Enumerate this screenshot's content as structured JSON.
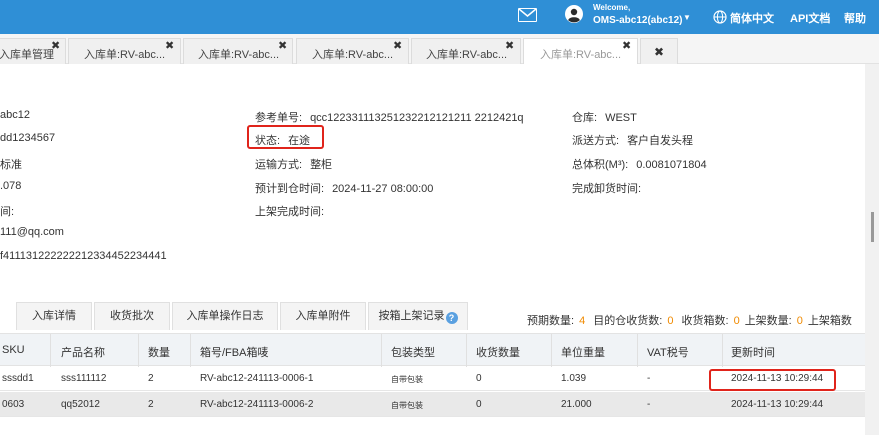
{
  "header": {
    "welcome": "Welcome,",
    "user": "OMS-abc12(abc12)",
    "language": "简体中文",
    "api_doc": "API文档",
    "help": "帮助"
  },
  "tabs": [
    {
      "label": "入库单管理",
      "active": false
    },
    {
      "label": "入库单:RV-abc...",
      "active": false
    },
    {
      "label": "入库单:RV-abc...",
      "active": false
    },
    {
      "label": "入库单:RV-abc...",
      "active": false
    },
    {
      "label": "入库单:RV-abc...",
      "active": false
    },
    {
      "label": "入库单:RV-abc...",
      "active": true
    }
  ],
  "details": {
    "col1": [
      "abc12",
      "dd1234567",
      "标准",
      ".078",
      "间:",
      "111@qq.com",
      "f411131222222212334452234441"
    ],
    "ref_label": "参考单号:",
    "ref_value": "qcc122331113251232212121211 2212421q",
    "status_label": "状态:",
    "status_value": "在途",
    "transport_label": "运输方式:",
    "transport_value": "整柜",
    "eta_label": "预计到仓时间:",
    "eta_value": "2024-11-27 08:00:00",
    "shelf_done_label": "上架完成时间:",
    "warehouse_label": "仓库:",
    "warehouse_value": "WEST",
    "delivery_label": "派送方式:",
    "delivery_value": "客户自发头程",
    "volume_label": "总体积(M³):",
    "volume_value": "0.0081071804",
    "unload_done_label": "完成卸货时间:"
  },
  "subtabs": [
    "入库详情",
    "收货批次",
    "入库单操作日志",
    "入库单附件",
    "按箱上架记录"
  ],
  "summary": {
    "expected_label": "预期数量:",
    "expected": "4",
    "dest_boxes_label": "目的仓收货数:",
    "dest_boxes": "0",
    "received_boxes_label": "收货箱数:",
    "received_boxes": "0",
    "shelved_label": "上架数量:",
    "shelved": "0",
    "shelved_boxes_label": "上架箱数"
  },
  "table": {
    "headers": [
      "SKU",
      "产品名称",
      "数量",
      "箱号/FBA箱唛",
      "包装类型",
      "收货数量",
      "单位重量",
      "VAT税号",
      "更新时间"
    ],
    "rows": [
      [
        "sssdd1",
        "sss111112",
        "2",
        "RV-abc12-241113-0006-1",
        "自带包装",
        "0",
        "1.039",
        "-",
        "2024-11-13 10:29:44"
      ],
      [
        "0603",
        "qq52012",
        "2",
        "RV-abc12-241113-0006-2",
        "自带包装",
        "0",
        "21.000",
        "-",
        "2024-11-13 10:29:44"
      ]
    ]
  },
  "colors": {
    "topbar": "#2f8fd6",
    "highlight": "#e0241b",
    "accent_number": "#f08a00"
  }
}
